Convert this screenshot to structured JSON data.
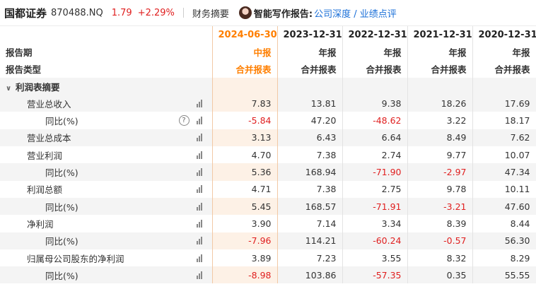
{
  "header": {
    "stock_name": "国都证券",
    "stock_code": "870488.NQ",
    "price": "1.79",
    "change": "+2.29%",
    "fin_summary_tab": "财务摘要",
    "ai_label": "智能写作报告:",
    "ai_link": "公司深度 / 业绩点评"
  },
  "table": {
    "row_labels": {
      "period": "报告期",
      "type": "报告类型",
      "section": "利润表摘要"
    },
    "columns": [
      {
        "date": "2024-06-30",
        "period": "中报",
        "type": "合并报表"
      },
      {
        "date": "2023-12-31",
        "period": "年报",
        "type": "合并报表"
      },
      {
        "date": "2022-12-31",
        "period": "年报",
        "type": "合并报表"
      },
      {
        "date": "2021-12-31",
        "period": "年报",
        "type": "合并报表"
      },
      {
        "date": "2020-12-31",
        "period": "年报",
        "type": "合并报表"
      }
    ],
    "rows": [
      {
        "label": "营业总收入",
        "values": [
          "7.83",
          "13.81",
          "9.38",
          "18.26",
          "17.69"
        ]
      },
      {
        "label": "同比(%)",
        "values": [
          "-5.84",
          "47.20",
          "-48.62",
          "3.22",
          "18.17"
        ]
      },
      {
        "label": "营业总成本",
        "values": [
          "3.13",
          "6.43",
          "6.64",
          "8.49",
          "7.62"
        ]
      },
      {
        "label": "营业利润",
        "values": [
          "4.70",
          "7.38",
          "2.74",
          "9.77",
          "10.07"
        ]
      },
      {
        "label": "同比(%)",
        "values": [
          "5.36",
          "168.94",
          "-71.90",
          "-2.97",
          "47.34"
        ]
      },
      {
        "label": "利润总额",
        "values": [
          "4.71",
          "7.38",
          "2.75",
          "9.78",
          "10.11"
        ]
      },
      {
        "label": "同比(%)",
        "values": [
          "5.45",
          "168.57",
          "-71.91",
          "-3.21",
          "47.60"
        ]
      },
      {
        "label": "净利润",
        "values": [
          "3.90",
          "7.14",
          "3.34",
          "8.39",
          "8.44"
        ]
      },
      {
        "label": "同比(%)",
        "values": [
          "-7.96",
          "114.21",
          "-60.24",
          "-0.57",
          "56.30"
        ]
      },
      {
        "label": "归属母公司股东的净利润",
        "values": [
          "3.89",
          "7.23",
          "3.55",
          "8.32",
          "8.29"
        ]
      },
      {
        "label": "同比(%)",
        "values": [
          "-8.98",
          "103.86",
          "-57.35",
          "0.35",
          "55.55"
        ]
      }
    ]
  }
}
